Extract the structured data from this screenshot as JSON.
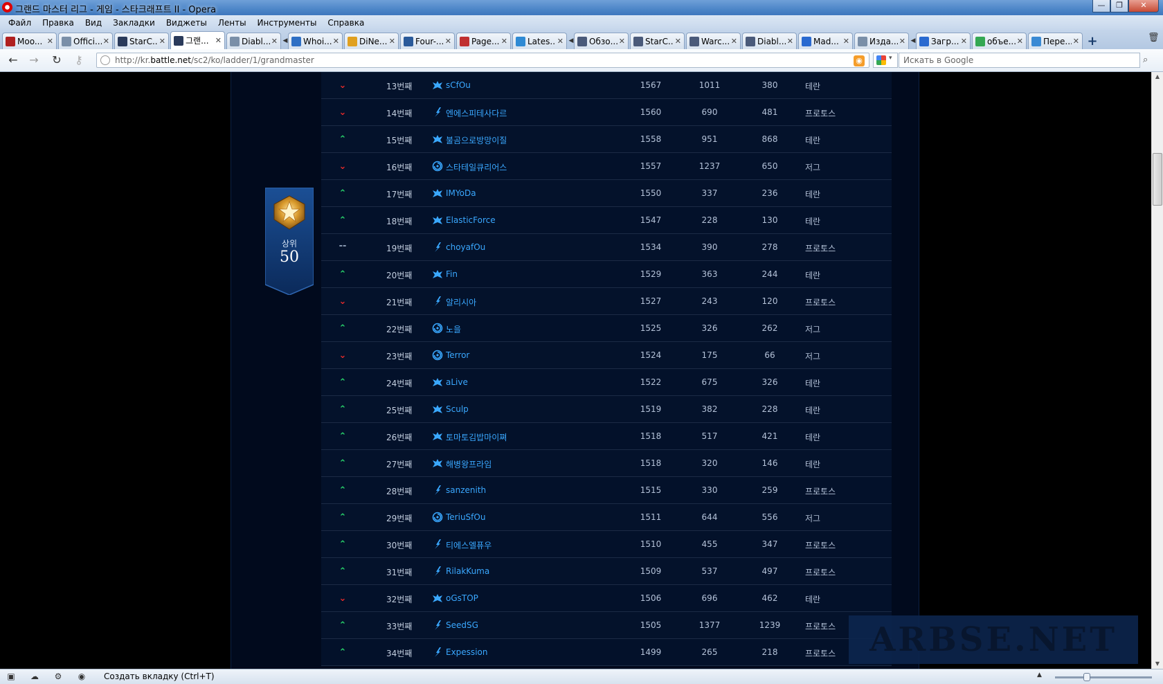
{
  "window": {
    "title": "그랜드 마스터 리그 - 게임 - 스타크래프트 II - Opera",
    "controls": {
      "minimize": "—",
      "maximize": "❐",
      "close": "✕"
    }
  },
  "menu": [
    "Файл",
    "Правка",
    "Вид",
    "Закладки",
    "Виджеты",
    "Ленты",
    "Инструменты",
    "Справка"
  ],
  "tabs": [
    {
      "label": "Moo...",
      "color": "#b02020"
    },
    {
      "label": "Offici...",
      "color": "#7a8fa8"
    },
    {
      "label": "StarC...",
      "color": "#2a3a5a"
    },
    {
      "label": "그랜...",
      "color": "#2a3a5a",
      "active": true
    },
    {
      "label": "Diabl...",
      "color": "#7a8fa8"
    },
    {
      "label": "Whoi...",
      "color": "#2e6fc4"
    },
    {
      "label": "DiNe...",
      "color": "#e0a020"
    },
    {
      "label": "Four-...",
      "color": "#2a5a9a"
    },
    {
      "label": "Page...",
      "color": "#c03030"
    },
    {
      "label": "Lates...",
      "color": "#2e8ad4"
    },
    {
      "label": "Обзо...",
      "color": "#4a5a7a"
    },
    {
      "label": "StarC...",
      "color": "#4a5a7a"
    },
    {
      "label": "Warc...",
      "color": "#4a5a7a"
    },
    {
      "label": "Diabl...",
      "color": "#4a5a7a"
    },
    {
      "label": "Mad...",
      "color": "#2a6ad0"
    },
    {
      "label": "Изда...",
      "color": "#7a8fa8"
    },
    {
      "label": "Загр...",
      "color": "#2a6ad0"
    },
    {
      "label": "объе...",
      "color": "#34a853"
    },
    {
      "label": "Пере...",
      "color": "#3a8ad4"
    }
  ],
  "address": {
    "prefix": "http://kr.",
    "domain": "battle.net",
    "path": "/sc2/ko/ladder/1/grandmaster"
  },
  "search": {
    "placeholder": "Искать в Google"
  },
  "badge": {
    "label": "상위",
    "value": "50"
  },
  "ladder": [
    {
      "trend": "down",
      "rank": "13번째",
      "race_icon": "terran",
      "name": "sCfOu",
      "points": "1567",
      "wins": "1011",
      "losses": "380",
      "race": "테란"
    },
    {
      "trend": "down",
      "rank": "14번째",
      "race_icon": "protoss",
      "name": "엔에스피테사다르",
      "points": "1560",
      "wins": "690",
      "losses": "481",
      "race": "프로토스"
    },
    {
      "trend": "up",
      "rank": "15번째",
      "race_icon": "terran",
      "name": "불곰으로방망이질",
      "points": "1558",
      "wins": "951",
      "losses": "868",
      "race": "테란"
    },
    {
      "trend": "down",
      "rank": "16번째",
      "race_icon": "zerg",
      "name": "스타테일큐리어스",
      "points": "1557",
      "wins": "1237",
      "losses": "650",
      "race": "저그"
    },
    {
      "trend": "up",
      "rank": "17번째",
      "race_icon": "terran",
      "name": "IMYoDa",
      "points": "1550",
      "wins": "337",
      "losses": "236",
      "race": "테란"
    },
    {
      "trend": "up",
      "rank": "18번째",
      "race_icon": "terran",
      "name": "ElasticForce",
      "points": "1547",
      "wins": "228",
      "losses": "130",
      "race": "테란"
    },
    {
      "trend": "same",
      "rank": "19번째",
      "race_icon": "protoss",
      "name": "choyafOu",
      "points": "1534",
      "wins": "390",
      "losses": "278",
      "race": "프로토스"
    },
    {
      "trend": "up",
      "rank": "20번째",
      "race_icon": "terran",
      "name": "Fin",
      "points": "1529",
      "wins": "363",
      "losses": "244",
      "race": "테란"
    },
    {
      "trend": "down",
      "rank": "21번째",
      "race_icon": "protoss",
      "name": "알리시아",
      "points": "1527",
      "wins": "243",
      "losses": "120",
      "race": "프로토스"
    },
    {
      "trend": "up",
      "rank": "22번째",
      "race_icon": "zerg",
      "name": "노을",
      "points": "1525",
      "wins": "326",
      "losses": "262",
      "race": "저그"
    },
    {
      "trend": "down",
      "rank": "23번째",
      "race_icon": "zerg",
      "name": "Terror",
      "points": "1524",
      "wins": "175",
      "losses": "66",
      "race": "저그"
    },
    {
      "trend": "up",
      "rank": "24번째",
      "race_icon": "terran",
      "name": "aLive",
      "points": "1522",
      "wins": "675",
      "losses": "326",
      "race": "테란"
    },
    {
      "trend": "up",
      "rank": "25번째",
      "race_icon": "terran",
      "name": "Sculp",
      "points": "1519",
      "wins": "382",
      "losses": "228",
      "race": "테란"
    },
    {
      "trend": "up",
      "rank": "26번째",
      "race_icon": "terran",
      "name": "토마토김밥마이쪄",
      "points": "1518",
      "wins": "517",
      "losses": "421",
      "race": "테란"
    },
    {
      "trend": "up",
      "rank": "27번째",
      "race_icon": "terran",
      "name": "해병왕프라임",
      "points": "1518",
      "wins": "320",
      "losses": "146",
      "race": "테란"
    },
    {
      "trend": "up",
      "rank": "28번째",
      "race_icon": "protoss",
      "name": "sanzenith",
      "points": "1515",
      "wins": "330",
      "losses": "259",
      "race": "프로토스"
    },
    {
      "trend": "up",
      "rank": "29번째",
      "race_icon": "zerg",
      "name": "TeriuSfOu",
      "points": "1511",
      "wins": "644",
      "losses": "556",
      "race": "저그"
    },
    {
      "trend": "up",
      "rank": "30번째",
      "race_icon": "protoss",
      "name": "티에스엘퓨우",
      "points": "1510",
      "wins": "455",
      "losses": "347",
      "race": "프로토스"
    },
    {
      "trend": "up",
      "rank": "31번째",
      "race_icon": "protoss",
      "name": "RilakKuma",
      "points": "1509",
      "wins": "537",
      "losses": "497",
      "race": "프로토스"
    },
    {
      "trend": "down",
      "rank": "32번째",
      "race_icon": "terran",
      "name": "oGsTOP",
      "points": "1506",
      "wins": "696",
      "losses": "462",
      "race": "테란"
    },
    {
      "trend": "up",
      "rank": "33번째",
      "race_icon": "protoss",
      "name": "SeedSG",
      "points": "1505",
      "wins": "1377",
      "losses": "1239",
      "race": "프로토스"
    },
    {
      "trend": "up",
      "rank": "34번째",
      "race_icon": "protoss",
      "name": "Expession",
      "points": "1499",
      "wins": "265",
      "losses": "218",
      "race": "프로토스"
    }
  ],
  "trend_symbols": {
    "up": "⌃",
    "down": "⌄",
    "same": "--"
  },
  "watermark": "ARBSE.NET",
  "status": {
    "text": "Создать вкладку (Ctrl+T)"
  },
  "colors": {
    "up": "#27d36b",
    "down": "#e62a2a",
    "player_name": "#3aa8ff",
    "race_icon": "#3aa8ff"
  }
}
